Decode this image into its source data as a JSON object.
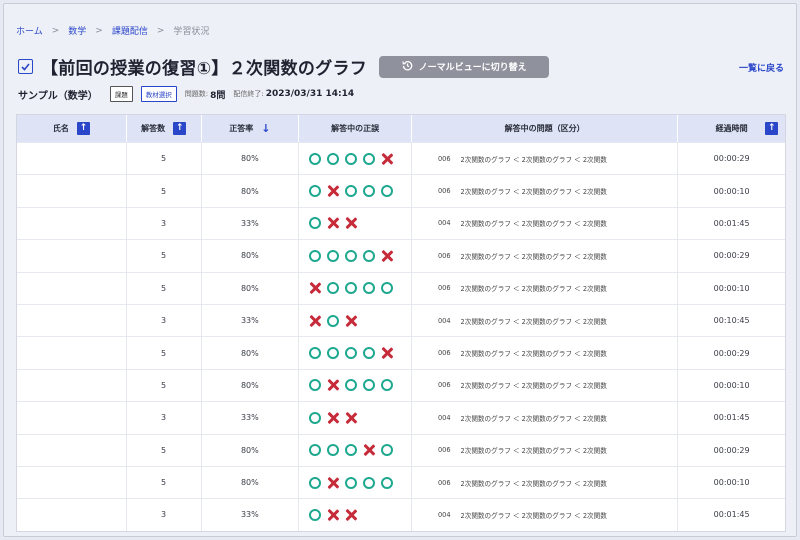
{
  "breadcrumb": {
    "items": [
      "ホーム",
      "数学",
      "課題配信"
    ],
    "current": "学習状況"
  },
  "header": {
    "title": "【前回の授業の復習①】２次関数のグラフ",
    "normal_view_label": "ノーマルビューに切り替え",
    "back_label": "一覧に戻る"
  },
  "meta": {
    "subject": "サンプル（数学）",
    "tag1": "課題",
    "tag2": "教材選択",
    "question_count_label": "問題数:",
    "question_count": "8問",
    "deadline_label": "配信終了:",
    "deadline": "2023/03/31 14:14"
  },
  "table": {
    "headers": {
      "name": "氏名",
      "answered": "解答数",
      "rate": "正答率",
      "marks": "解答中の正誤",
      "question": "解答中の問題（区分）",
      "time": "経過時間"
    },
    "rows": [
      {
        "name": "",
        "answered": "5",
        "rate": "80%",
        "marks": [
          "o",
          "o",
          "o",
          "o",
          "x"
        ],
        "qid": "006",
        "path": "2次関数のグラフ ＜ 2次関数のグラフ ＜ 2次関数",
        "time": "00:00:29"
      },
      {
        "name": "",
        "answered": "5",
        "rate": "80%",
        "marks": [
          "o",
          "x",
          "o",
          "o",
          "o"
        ],
        "qid": "006",
        "path": "2次関数のグラフ ＜ 2次関数のグラフ ＜ 2次関数",
        "time": "00:00:10"
      },
      {
        "name": "",
        "answered": "3",
        "rate": "33%",
        "marks": [
          "o",
          "x",
          "x"
        ],
        "qid": "004",
        "path": "2次関数のグラフ ＜ 2次関数のグラフ ＜ 2次関数",
        "time": "00:01:45"
      },
      {
        "name": "",
        "answered": "5",
        "rate": "80%",
        "marks": [
          "o",
          "o",
          "o",
          "o",
          "x"
        ],
        "qid": "006",
        "path": "2次関数のグラフ ＜ 2次関数のグラフ ＜ 2次関数",
        "time": "00:00:29"
      },
      {
        "name": "",
        "answered": "5",
        "rate": "80%",
        "marks": [
          "x",
          "o",
          "o",
          "o",
          "o"
        ],
        "qid": "006",
        "path": "2次関数のグラフ ＜ 2次関数のグラフ ＜ 2次関数",
        "time": "00:00:10"
      },
      {
        "name": "",
        "answered": "3",
        "rate": "33%",
        "marks": [
          "x",
          "o",
          "x"
        ],
        "qid": "004",
        "path": "2次関数のグラフ ＜ 2次関数のグラフ ＜ 2次関数",
        "time": "00:10:45"
      },
      {
        "name": "",
        "answered": "5",
        "rate": "80%",
        "marks": [
          "o",
          "o",
          "o",
          "o",
          "x"
        ],
        "qid": "006",
        "path": "2次関数のグラフ ＜ 2次関数のグラフ ＜ 2次関数",
        "time": "00:00:29"
      },
      {
        "name": "",
        "answered": "5",
        "rate": "80%",
        "marks": [
          "o",
          "x",
          "o",
          "o",
          "o"
        ],
        "qid": "006",
        "path": "2次関数のグラフ ＜ 2次関数のグラフ ＜ 2次関数",
        "time": "00:00:10"
      },
      {
        "name": "",
        "answered": "3",
        "rate": "33%",
        "marks": [
          "o",
          "x",
          "x"
        ],
        "qid": "004",
        "path": "2次関数のグラフ ＜ 2次関数のグラフ ＜ 2次関数",
        "time": "00:01:45"
      },
      {
        "name": "",
        "answered": "5",
        "rate": "80%",
        "marks": [
          "o",
          "o",
          "o",
          "x",
          "o"
        ],
        "qid": "006",
        "path": "2次関数のグラフ ＜ 2次関数のグラフ ＜ 2次関数",
        "time": "00:00:29"
      },
      {
        "name": "",
        "answered": "5",
        "rate": "80%",
        "marks": [
          "o",
          "x",
          "o",
          "o",
          "o"
        ],
        "qid": "006",
        "path": "2次関数のグラフ ＜ 2次関数のグラフ ＜ 2次関数",
        "time": "00:00:10"
      },
      {
        "name": "",
        "answered": "3",
        "rate": "33%",
        "marks": [
          "o",
          "x",
          "x"
        ],
        "qid": "004",
        "path": "2次関数のグラフ ＜ 2次関数のグラフ ＜ 2次関数",
        "time": "00:01:45"
      }
    ]
  },
  "colors": {
    "accent": "#2b47c9",
    "correct": "#1ea88f",
    "wrong": "#c62b3a",
    "header_bg": "#dee3f5"
  }
}
